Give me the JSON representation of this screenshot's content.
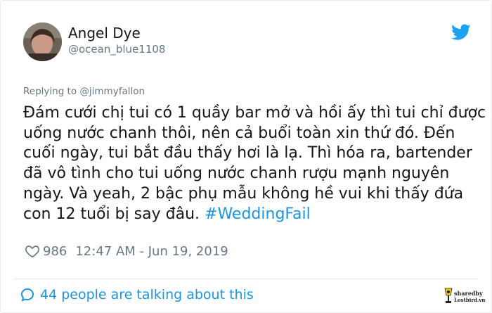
{
  "tweet": {
    "author_name": "Angel Dye",
    "author_handle": "@ocean_blue1108",
    "replying_prefix": "Replying to ",
    "replying_to": "@jimmyfallon",
    "text": "Đám cưới chị tui có 1 quầy bar mở và hồi ấy thì tui chỉ được uống nước chanh thôi, nên cả buổi toàn xin thứ đó. Đến cuối ngày, tui bắt đầu thấy hơi là lạ. Thì hóa ra, bartender đã vô tình cho tui uống nước chanh rượu mạnh nguyên ngày. Và yeah, 2 bậc phụ mẫu không hề vui khi thấy đứa con 12 tuổi bị say đâu. ",
    "hashtag": "#WeddingFail",
    "likes": "986",
    "timestamp": "12:47 AM - Jun 19, 2019",
    "talking": "44 people are talking about this"
  },
  "watermark": {
    "line1": "sharedby",
    "line2": "Lostbird.vn"
  },
  "icons": {
    "twitter": "twitter-bird-icon",
    "heart": "heart-icon",
    "bubble": "speech-bubble-icon",
    "watermark": "lostbird-logo-icon"
  },
  "colors": {
    "brand": "#1da1f2",
    "link": "#1b95e0",
    "text": "#14171a",
    "muted": "#657786",
    "border": "#e6ecf0"
  }
}
